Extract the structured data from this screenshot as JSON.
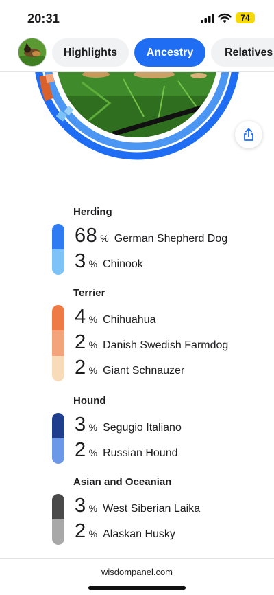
{
  "status": {
    "time": "20:31",
    "battery": "74",
    "colors": {
      "battery": "#f5d90a"
    }
  },
  "tabs": [
    {
      "label": "Highlights",
      "active": false
    },
    {
      "label": "Ancestry",
      "active": true
    },
    {
      "label": "Relatives",
      "active": false
    }
  ],
  "accent_color": "#1f6df2",
  "groups": [
    {
      "title": "Herding",
      "breeds": [
        {
          "percent": "68",
          "sign": "%",
          "name": "German Shepherd Dog",
          "color": "#2f7cf2"
        },
        {
          "percent": "3",
          "sign": "%",
          "name": "Chinook",
          "color": "#7ec3f8"
        }
      ]
    },
    {
      "title": "Terrier",
      "breeds": [
        {
          "percent": "4",
          "sign": "%",
          "name": "Chihuahua",
          "color": "#ee7a45"
        },
        {
          "percent": "2",
          "sign": "%",
          "name": "Danish Swedish Farmdog",
          "color": "#f3a47a"
        },
        {
          "percent": "2",
          "sign": "%",
          "name": "Giant Schnauzer",
          "color": "#f8dbb9"
        }
      ]
    },
    {
      "title": "Hound",
      "breeds": [
        {
          "percent": "3",
          "sign": "%",
          "name": "Segugio Italiano",
          "color": "#1f3f8c"
        },
        {
          "percent": "2",
          "sign": "%",
          "name": "Russian Hound",
          "color": "#6c98e8"
        }
      ]
    },
    {
      "title": "Asian and Oceanian",
      "breeds": [
        {
          "percent": "3",
          "sign": "%",
          "name": "West Siberian Laika",
          "color": "#4a4a4a"
        },
        {
          "percent": "2",
          "sign": "%",
          "name": "Alaskan Husky",
          "color": "#a8a8a8"
        }
      ]
    }
  ],
  "footer": {
    "site": "wisdompanel.com"
  }
}
